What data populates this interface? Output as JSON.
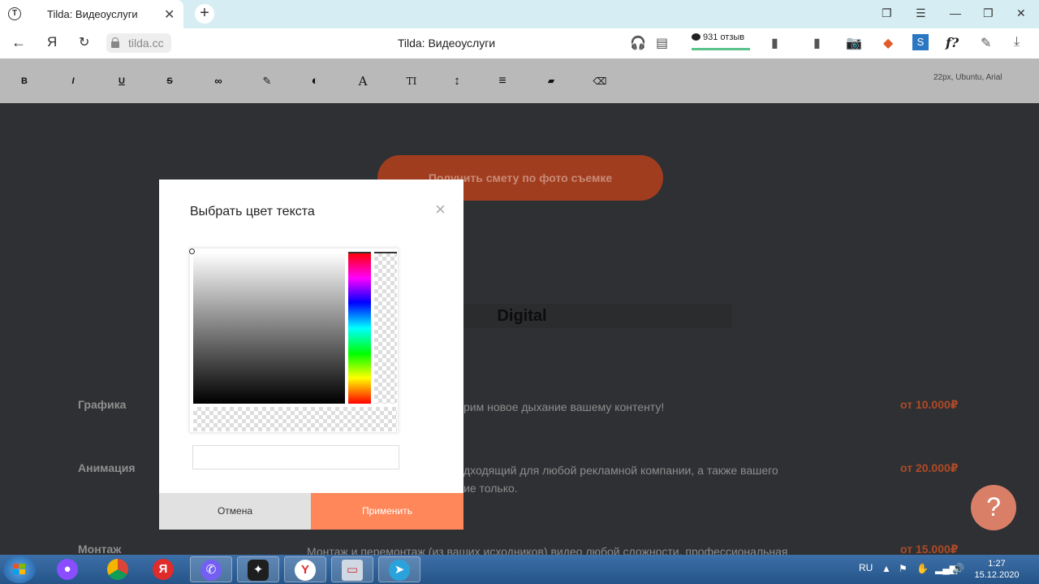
{
  "browser": {
    "tab_title": "Tilda: Видеоуслуги",
    "tab_icon": "Т",
    "new_tab_symbol": "+",
    "close_symbol": "✕",
    "url": "tilda.cc",
    "page_title": "Tilda: Видеоуслуги",
    "reviews_label": "931 отзыв",
    "yandex_letter": "Я"
  },
  "toolbar": {
    "bold": "B",
    "italic": "I",
    "underline": "U",
    "strike": "S",
    "link": "∞",
    "brush": "✎",
    "contrast": "◐",
    "font": "A",
    "text_size": "TI",
    "line_height": "↕",
    "align": "≡",
    "book": "▰",
    "eraser": "⌫",
    "font_info": "22px, Ubuntu, Arial"
  },
  "page": {
    "cta_button": "Получить смету по фото съемке",
    "section_title": "Digital",
    "services": [
      {
        "name": "Графика",
        "desc": "рим новое дыхание вашему контенту!",
        "price": "от 10.000₽"
      },
      {
        "name": "Анимация",
        "desc_line1": "дходящий для любой рекламной компании, а также вашего",
        "desc_line2": "ие только.",
        "price": "от 20.000₽"
      },
      {
        "name": "Монтаж",
        "desc": "Монтаж и перемонтаж (из ваших исходников) видео любой сложности, профессиональная",
        "price": "от 15.000₽"
      }
    ],
    "help_symbol": "?"
  },
  "color_picker": {
    "title": "Выбрать цвет текста",
    "close_symbol": "×",
    "hex_value": "",
    "cancel_label": "Отмена",
    "apply_label": "Применить",
    "apply_color": "#ff8759"
  },
  "taskbar": {
    "yandex_letter": "Я",
    "language": "RU",
    "time": "1:27",
    "date": "15.12.2020"
  }
}
